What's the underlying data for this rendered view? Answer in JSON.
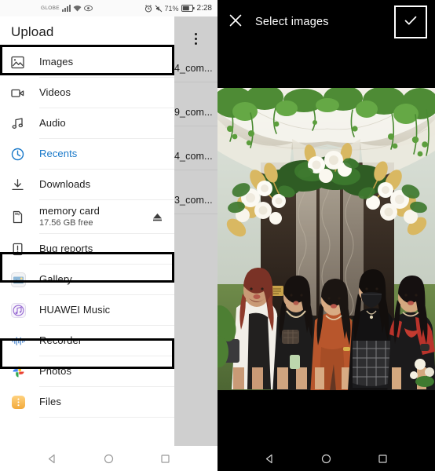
{
  "left_panel": {
    "statusbar": {
      "carrier": "GLOBE",
      "network_type": "4G",
      "signal_icon": "signal-bars-icon",
      "wifi_icon": "wifi-icon",
      "eye_icon": "eye-comfort-icon",
      "alarm_icon": "alarm-icon",
      "mute_icon": "vibrate-mute-icon",
      "battery_percent": "71%",
      "battery_icon": "battery-icon",
      "time": "2:28"
    },
    "drawer": {
      "title": "Upload",
      "overflow_icon": "overflow-menu-icon",
      "items": [
        {
          "label": "Images",
          "icon": "image-icon",
          "highlighted": true,
          "active": false
        },
        {
          "label": "Videos",
          "icon": "video-icon",
          "highlighted": false,
          "active": false
        },
        {
          "label": "Audio",
          "icon": "audio-icon",
          "highlighted": false,
          "active": false
        },
        {
          "label": "Recents",
          "icon": "clock-icon",
          "highlighted": false,
          "active": true
        },
        {
          "label": "Downloads",
          "icon": "download-icon",
          "highlighted": false,
          "active": false
        },
        {
          "label": "memory card",
          "sublabel": "17.56 GB free",
          "icon": "sdcard-icon",
          "trailing_icon": "eject-icon",
          "highlighted": false,
          "active": false
        },
        {
          "label": "Bug reports",
          "icon": "bug-report-icon",
          "highlighted": false,
          "active": false
        },
        {
          "label": "Gallery",
          "icon": "gallery-app-icon",
          "highlighted": true,
          "active": false
        },
        {
          "label": "HUAWEI Music",
          "icon": "huawei-music-icon",
          "highlighted": false,
          "active": false
        },
        {
          "label": "Recorder",
          "icon": "recorder-icon",
          "highlighted": false,
          "active": false
        },
        {
          "label": "Photos",
          "icon": "google-photos-icon",
          "highlighted": true,
          "active": false
        },
        {
          "label": "Files",
          "icon": "files-app-icon",
          "highlighted": false,
          "active": false
        }
      ],
      "accent_color": "#1878c9",
      "highlight_color": "#000000"
    },
    "background_file_list": [
      "4_com...",
      "9_com...",
      "4_com...",
      "3_com..."
    ],
    "navbar": {
      "back_icon": "back-triangle-icon",
      "home_icon": "home-circle-icon",
      "recents_icon": "recents-square-icon"
    }
  },
  "right_panel": {
    "appbar": {
      "close_icon": "close-x-icon",
      "title": "Select images",
      "confirm_icon": "checkmark-icon",
      "confirm_highlighted": true
    },
    "photo": {
      "alt": "Five women posing together under a white and gold floral wedding arch with hanging greenery"
    },
    "navbar": {
      "back_icon": "back-triangle-icon",
      "home_icon": "home-circle-icon",
      "recents_icon": "recents-square-icon"
    }
  }
}
